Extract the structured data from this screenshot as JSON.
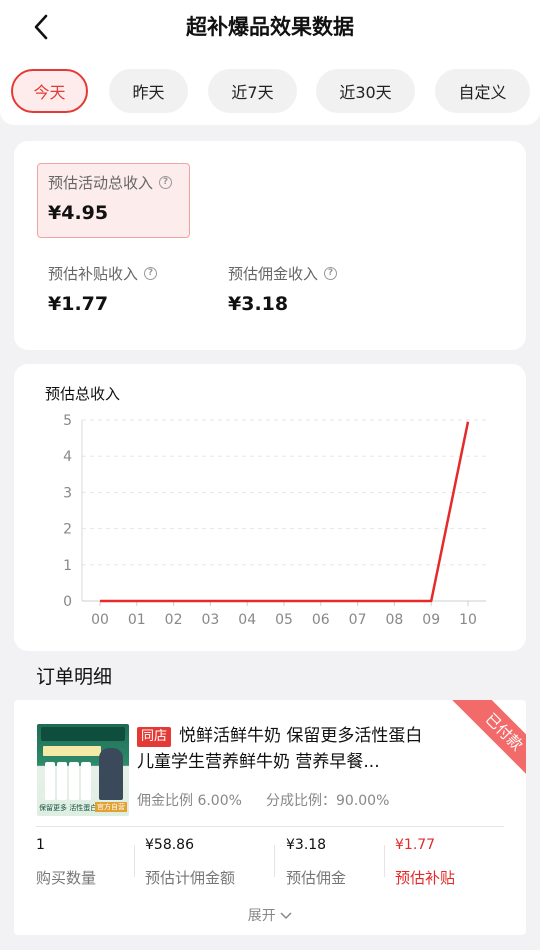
{
  "header": {
    "title": "超补爆品效果数据"
  },
  "tabs": [
    {
      "label": "今天",
      "active": true
    },
    {
      "label": "昨天",
      "active": false
    },
    {
      "label": "近7天",
      "active": false
    },
    {
      "label": "近30天",
      "active": false
    },
    {
      "label": "自定义",
      "active": false
    }
  ],
  "summary": {
    "total_label": "预估活动总收入",
    "total_value": "¥4.95",
    "subsidy_label": "预估补贴收入",
    "subsidy_value": "¥1.77",
    "commission_label": "预估佣金收入",
    "commission_value": "¥3.18"
  },
  "chart_data": {
    "type": "line",
    "title": "预估总收入",
    "categories": [
      "00",
      "01",
      "02",
      "03",
      "04",
      "05",
      "06",
      "07",
      "08",
      "09",
      "10"
    ],
    "series": [
      {
        "values": [
          0,
          0,
          0,
          0,
          0,
          0,
          0,
          0,
          0,
          0,
          4.95
        ]
      }
    ],
    "ylim": [
      0,
      5
    ],
    "yticks": [
      0,
      1,
      2,
      3,
      4,
      5
    ],
    "grid": true,
    "line_color": "#e42a2a"
  },
  "orders": {
    "section_title": "订单明细",
    "item": {
      "status_ribbon": "已付款",
      "store_tag": "同店",
      "title": "悦鲜活鲜牛奶 保留更多活性蛋白儿童学生营养鲜牛奶 营养早餐...",
      "commission_rate": "佣金比例 6.00%",
      "share_rate": "分成比例：90.00%",
      "stats": [
        {
          "value": "1",
          "label": "购买数量",
          "highlight": false
        },
        {
          "value": "¥58.86",
          "label": "预估计佣金额",
          "highlight": false
        },
        {
          "value": "¥3.18",
          "label": "预估佣金",
          "highlight": false
        },
        {
          "value": "¥1.77",
          "label": "预估补贴",
          "highlight": true
        }
      ],
      "image_caption": "保留更多 活性蛋白",
      "image_badge": "官方自营"
    },
    "expand_label": "展开"
  },
  "colors": {
    "accent": "#e43a36",
    "page_bg": "#f2f2f4"
  }
}
